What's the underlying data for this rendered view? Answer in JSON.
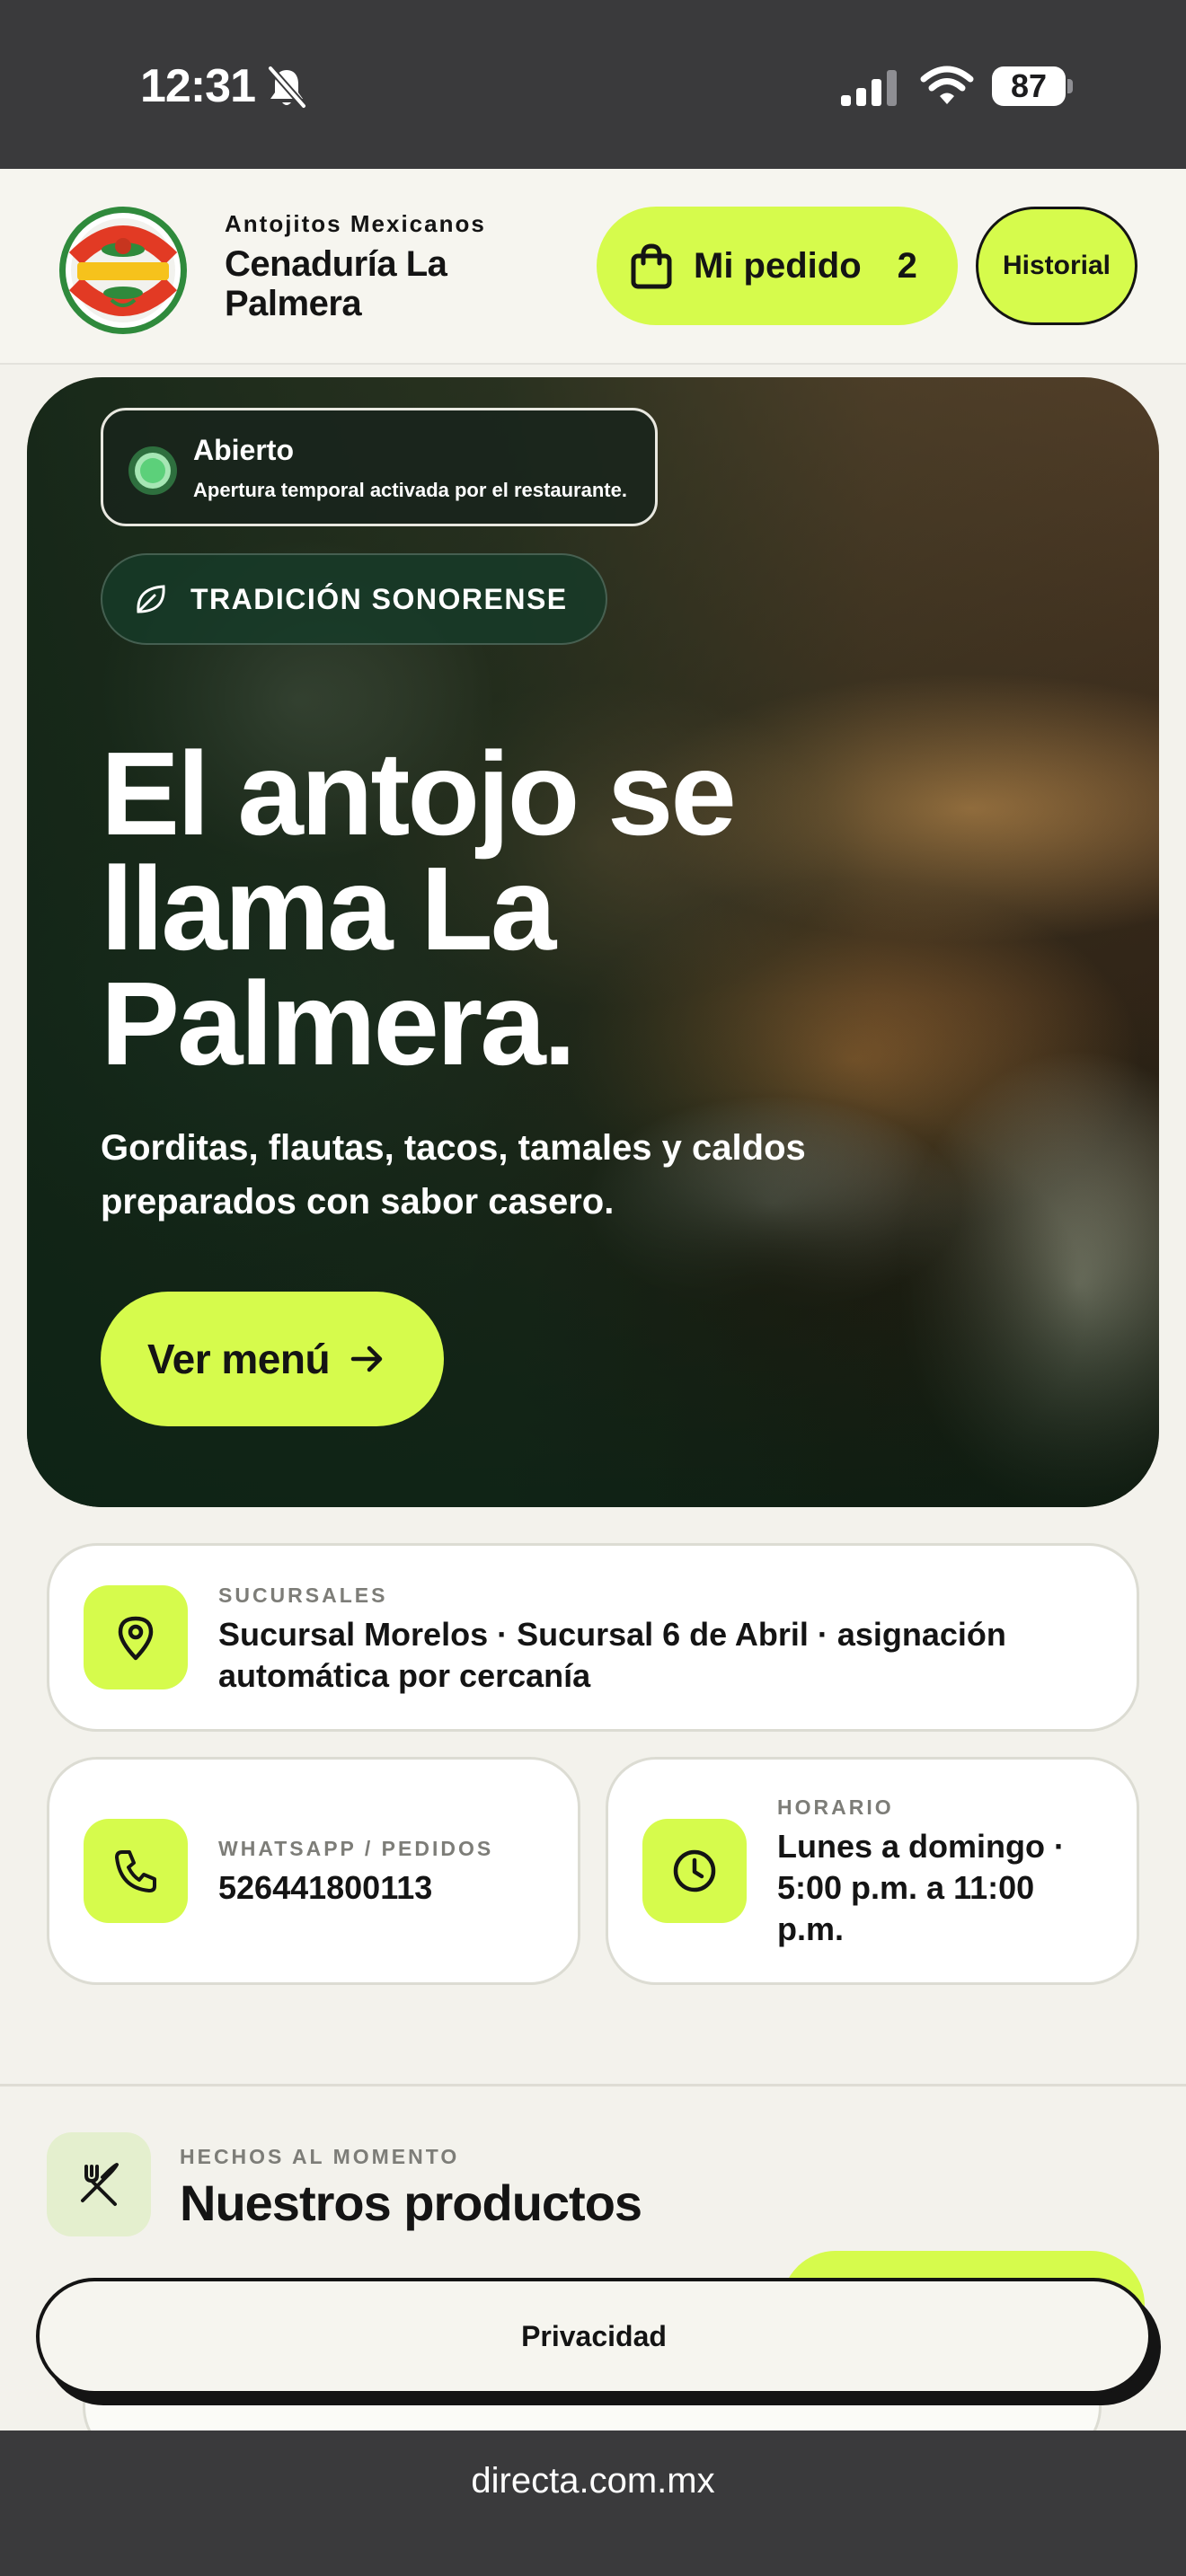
{
  "status_bar": {
    "time": "12:31",
    "battery": "87",
    "icons": [
      "bell-slash-icon",
      "cellular-signal-icon",
      "wifi-icon",
      "battery-icon"
    ]
  },
  "header": {
    "logo_text": [
      "CENADURÍA",
      "Antojitos Mexicanos",
      "LA PALMERA"
    ],
    "tagline": "Antojitos Mexicanos",
    "brand": "Cenaduría La Palmera",
    "order_label": "Mi pedido",
    "order_count": "2",
    "history_label": "Historial"
  },
  "hero": {
    "status_title": "Abierto",
    "status_subtitle": "Apertura temporal activada por el restaurante.",
    "tradition": "TRADICIÓN SONORENSE",
    "title": "El antojo se llama La Palmera.",
    "subtitle": "Gorditas, flautas, tacos, tamales y caldos preparados con sabor casero.",
    "cta": "Ver menú"
  },
  "info": {
    "branches": {
      "kicker": "SUCURSALES",
      "value": "Sucursal Morelos · Sucursal 6 de Abril · asignación automática por cercanía"
    },
    "whatsapp": {
      "kicker": "WHATSAPP / PEDIDOS",
      "value": "526441800113"
    },
    "hours": {
      "kicker": "HORARIO",
      "value": "Lunes a domingo · 5:00 p.m. a 11:00 p.m."
    }
  },
  "products": {
    "kicker": "HECHOS AL MOMENTO",
    "title": "Nuestros productos"
  },
  "privacy": {
    "label": "Privacidad"
  },
  "url_bar": {
    "url": "directa.com.mx"
  },
  "colors": {
    "accent": "#d6fb4c",
    "dark": "#141414",
    "background": "#f3f2ec",
    "open_green": "#5cd07a",
    "hero_green": "#0e2416"
  }
}
